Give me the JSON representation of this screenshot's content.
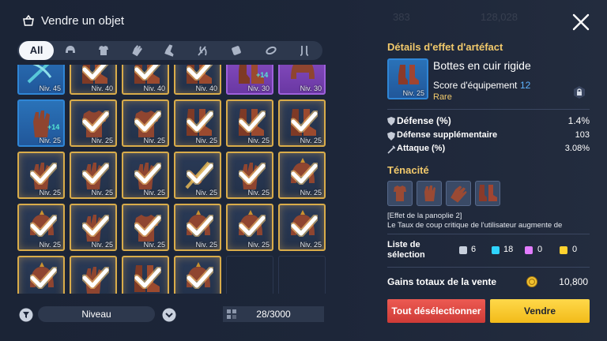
{
  "header": {
    "title": "Vendre un objet",
    "ghost_texts": [
      "383",
      "128,028",
      "Rare"
    ],
    "icons": {
      "title": "basket-icon",
      "close": "close-icon"
    }
  },
  "filters": {
    "all_label": "All",
    "categories": [
      "helmet-icon",
      "armor-icon",
      "gloves-icon",
      "boots-icon",
      "weapon-icon",
      "scroll-icon",
      "ring-icon",
      "earring-icon"
    ]
  },
  "grid": {
    "items": [
      {
        "level": "Niv. 45",
        "rarity": "blue",
        "selected": false,
        "plus": "",
        "icon": "crossbow-icon"
      },
      {
        "level": "Niv. 40",
        "rarity": "normal",
        "selected": true,
        "plus": "",
        "icon": "boots-icon"
      },
      {
        "level": "Niv. 40",
        "rarity": "normal",
        "selected": true,
        "plus": "",
        "icon": "boots-icon"
      },
      {
        "level": "Niv. 40",
        "rarity": "normal",
        "selected": true,
        "plus": "",
        "icon": "boots-icon"
      },
      {
        "level": "Niv. 30",
        "rarity": "purple",
        "selected": false,
        "plus": "+14",
        "icon": "boots-icon"
      },
      {
        "level": "Niv. 30",
        "rarity": "purple",
        "selected": false,
        "plus": "",
        "icon": "helmet-icon"
      },
      {
        "level": "Niv. 25",
        "rarity": "blue",
        "selected": false,
        "plus": "+14",
        "icon": "gloves-icon"
      },
      {
        "level": "Niv. 25",
        "rarity": "normal",
        "selected": true,
        "plus": "",
        "icon": "armor-icon"
      },
      {
        "level": "Niv. 25",
        "rarity": "normal",
        "selected": true,
        "plus": "",
        "icon": "armor-icon"
      },
      {
        "level": "Niv. 25",
        "rarity": "normal",
        "selected": true,
        "plus": "",
        "icon": "boots-icon"
      },
      {
        "level": "Niv. 25",
        "rarity": "normal",
        "selected": true,
        "plus": "",
        "icon": "boots-icon"
      },
      {
        "level": "Niv. 25",
        "rarity": "normal",
        "selected": true,
        "plus": "",
        "icon": "boots-icon"
      },
      {
        "level": "Niv. 25",
        "rarity": "normal",
        "selected": true,
        "plus": "",
        "icon": "gloves-icon"
      },
      {
        "level": "Niv. 25",
        "rarity": "normal",
        "selected": true,
        "plus": "",
        "icon": "gloves-icon"
      },
      {
        "level": "Niv. 25",
        "rarity": "normal",
        "selected": true,
        "plus": "",
        "icon": "gloves-icon"
      },
      {
        "level": "Niv. 25",
        "rarity": "normal",
        "selected": true,
        "plus": "",
        "icon": "weapon-icon"
      },
      {
        "level": "Niv. 25",
        "rarity": "normal",
        "selected": true,
        "plus": "",
        "icon": "gloves-icon"
      },
      {
        "level": "Niv. 25",
        "rarity": "normal",
        "selected": true,
        "plus": "",
        "icon": "helmet-icon"
      },
      {
        "level": "Niv. 25",
        "rarity": "normal",
        "selected": true,
        "plus": "",
        "icon": "helmet-icon"
      },
      {
        "level": "Niv. 25",
        "rarity": "normal",
        "selected": true,
        "plus": "",
        "icon": "gloves-icon"
      },
      {
        "level": "Niv. 25",
        "rarity": "normal",
        "selected": true,
        "plus": "",
        "icon": "armor-icon"
      },
      {
        "level": "Niv. 25",
        "rarity": "normal",
        "selected": true,
        "plus": "",
        "icon": "helmet-icon"
      },
      {
        "level": "Niv. 25",
        "rarity": "normal",
        "selected": true,
        "plus": "",
        "icon": "helmet-icon"
      },
      {
        "level": "Niv. 25",
        "rarity": "normal",
        "selected": true,
        "plus": "",
        "icon": "helmet-icon"
      },
      {
        "level": "",
        "rarity": "normal",
        "selected": true,
        "plus": "",
        "icon": "helmet-icon"
      },
      {
        "level": "",
        "rarity": "normal",
        "selected": true,
        "plus": "",
        "icon": "gloves-icon"
      },
      {
        "level": "",
        "rarity": "normal",
        "selected": true,
        "plus": "",
        "icon": "boots-icon"
      },
      {
        "level": "",
        "rarity": "normal",
        "selected": true,
        "plus": "",
        "icon": "helmet-icon"
      },
      {
        "level": "",
        "rarity": "empty",
        "selected": false,
        "plus": "",
        "icon": ""
      },
      {
        "level": "",
        "rarity": "empty",
        "selected": false,
        "plus": "",
        "icon": ""
      }
    ]
  },
  "bottom_bar": {
    "sort_label": "Niveau",
    "count": "28/3000",
    "icons": {
      "filter": "filter-icon",
      "chevron": "chevron-down-icon",
      "bag": "inventory-icon"
    }
  },
  "detail": {
    "heading": "Détails d'effet d'artéfact",
    "item_name": "Bottes en cuir rigide",
    "item_level": "Niv. 25",
    "score_label": "Score d'équipement",
    "score_value": "12",
    "rarity": "Rare",
    "stats": [
      {
        "name": "Défense (%)",
        "value": "1.4%",
        "icon": "shield-icon"
      },
      {
        "name": "Défense supplémentaire",
        "value": "103",
        "icon": "shield-icon"
      },
      {
        "name": "Attaque (%)",
        "value": "3.08%",
        "icon": "sword-icon"
      }
    ],
    "set_name": "Ténacité",
    "set_icons": [
      "armor-icon",
      "gloves-icon",
      "gloves-icon",
      "boots-icon"
    ],
    "set_effect_title": "[Effet de la panoplie 2]",
    "set_effect_text": "Le Taux de coup critique de l'utilisateur augmente de",
    "selection_label": "Liste de sélection",
    "selection_counts": [
      {
        "color": "#c7cfdc",
        "value": "6"
      },
      {
        "color": "#2fd4ff",
        "value": "18"
      },
      {
        "color": "#e27cff",
        "value": "0"
      },
      {
        "color": "#ffd22f",
        "value": "0"
      }
    ],
    "gains_label": "Gains totaux de la vente",
    "gains_value": "10,800",
    "deselect_label": "Tout désélectionner",
    "sell_label": "Vendre"
  }
}
